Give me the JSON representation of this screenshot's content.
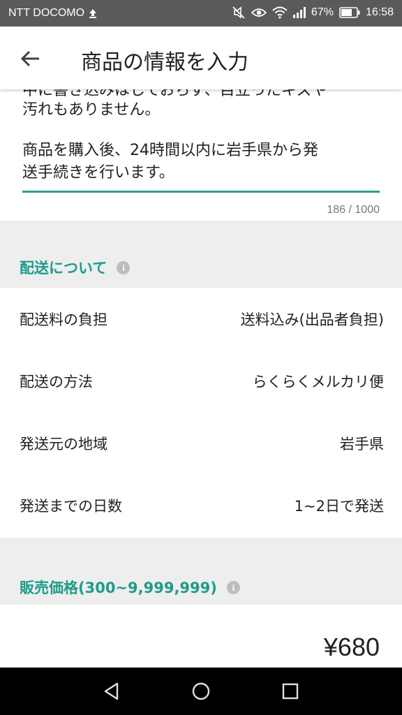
{
  "status": {
    "carrier": "NTT DOCOMO",
    "battery": "67%",
    "time": "16:58"
  },
  "header": {
    "title": "商品の情報を入力"
  },
  "description": {
    "partial_line": "中に書き込みはしておらず、目立ったキズや",
    "line2": "汚れもありません。",
    "paragraph2": "商品を購入後、24時間以内に岩手県から発\n送手続きを行います。",
    "counter": "186 / 1000"
  },
  "shipping": {
    "section_title": "配送について",
    "rows": [
      {
        "label": "配送料の負担",
        "value": "送料込み(出品者負担)"
      },
      {
        "label": "配送の方法",
        "value": "らくらくメルカリ便"
      },
      {
        "label": "発送元の地域",
        "value": "岩手県"
      },
      {
        "label": "発送までの日数",
        "value": "1~2日で発送"
      }
    ]
  },
  "price": {
    "section_title": "販売価格(300~9,999,999)",
    "value": "¥680"
  },
  "icons": {
    "back": "arrow-left-icon",
    "info": "info-icon",
    "nav": [
      "back-triangle-icon",
      "home-circle-icon",
      "recents-square-icon"
    ]
  },
  "colors": {
    "accent": "#1d9c8b",
    "status_bar": "#5a5a5a",
    "section_band": "#eeeeee"
  }
}
